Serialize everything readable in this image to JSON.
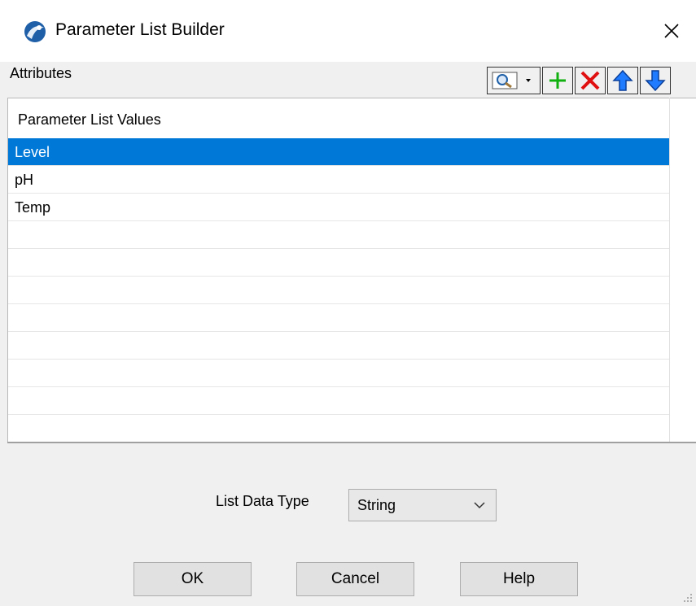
{
  "window": {
    "title": "Parameter List Builder",
    "close_label": "✕"
  },
  "attributes": {
    "label": "Attributes"
  },
  "toolbar": {
    "items": [
      {
        "name": "find-dropdown",
        "icon": "magnifier-icon"
      },
      {
        "name": "add",
        "icon": "plus-icon",
        "color": "#10b010"
      },
      {
        "name": "delete",
        "icon": "x-icon",
        "color": "#e01010"
      },
      {
        "name": "move-up",
        "icon": "arrow-up-icon",
        "color": "#1f7bff"
      },
      {
        "name": "move-down",
        "icon": "arrow-down-icon",
        "color": "#1f7bff"
      }
    ]
  },
  "grid": {
    "header": "Parameter List Values",
    "rows": [
      "Level",
      "pH",
      "Temp",
      "",
      "",
      "",
      "",
      "",
      "",
      "",
      ""
    ],
    "selected_index": 0,
    "selection_color": "#0078d7"
  },
  "list_data_type": {
    "label": "List Data Type",
    "value": "String"
  },
  "buttons": {
    "ok": "OK",
    "cancel": "Cancel",
    "help": "Help"
  }
}
